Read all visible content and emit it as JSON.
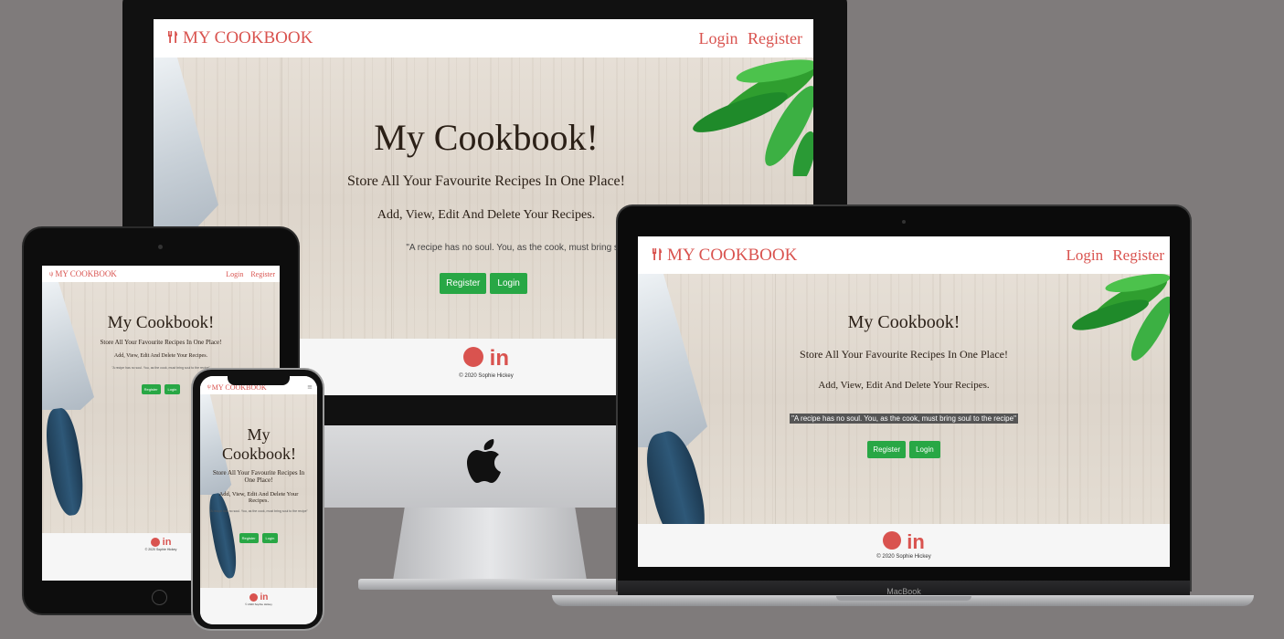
{
  "site": {
    "brand": "MY COOKBOOK",
    "nav_login": "Login",
    "nav_register": "Register",
    "hero_title": "My Cookbook!",
    "hero_subtitle": "Store All Your Favourite Recipes In One Place!",
    "hero_line2": "Add, View, Edit And Delete Your Recipes.",
    "quote": "\"A recipe has no soul. You, as the cook, must bring soul to the recipe\"",
    "quote_cut_desktop": "\"A recipe has no soul. You, as the cook, must bring soul to the recipe\"",
    "btn_register": "Register",
    "btn_login": "Login",
    "social_github": "github-icon",
    "social_linkedin": "in",
    "copyright": "© 2020 Sophie Hickey"
  },
  "devices": {
    "laptop_label": "MacBook"
  },
  "colors": {
    "background": "#7f7b7b",
    "brand": "#d9534f",
    "button": "#28a745",
    "footer": "#f6f6f6"
  }
}
